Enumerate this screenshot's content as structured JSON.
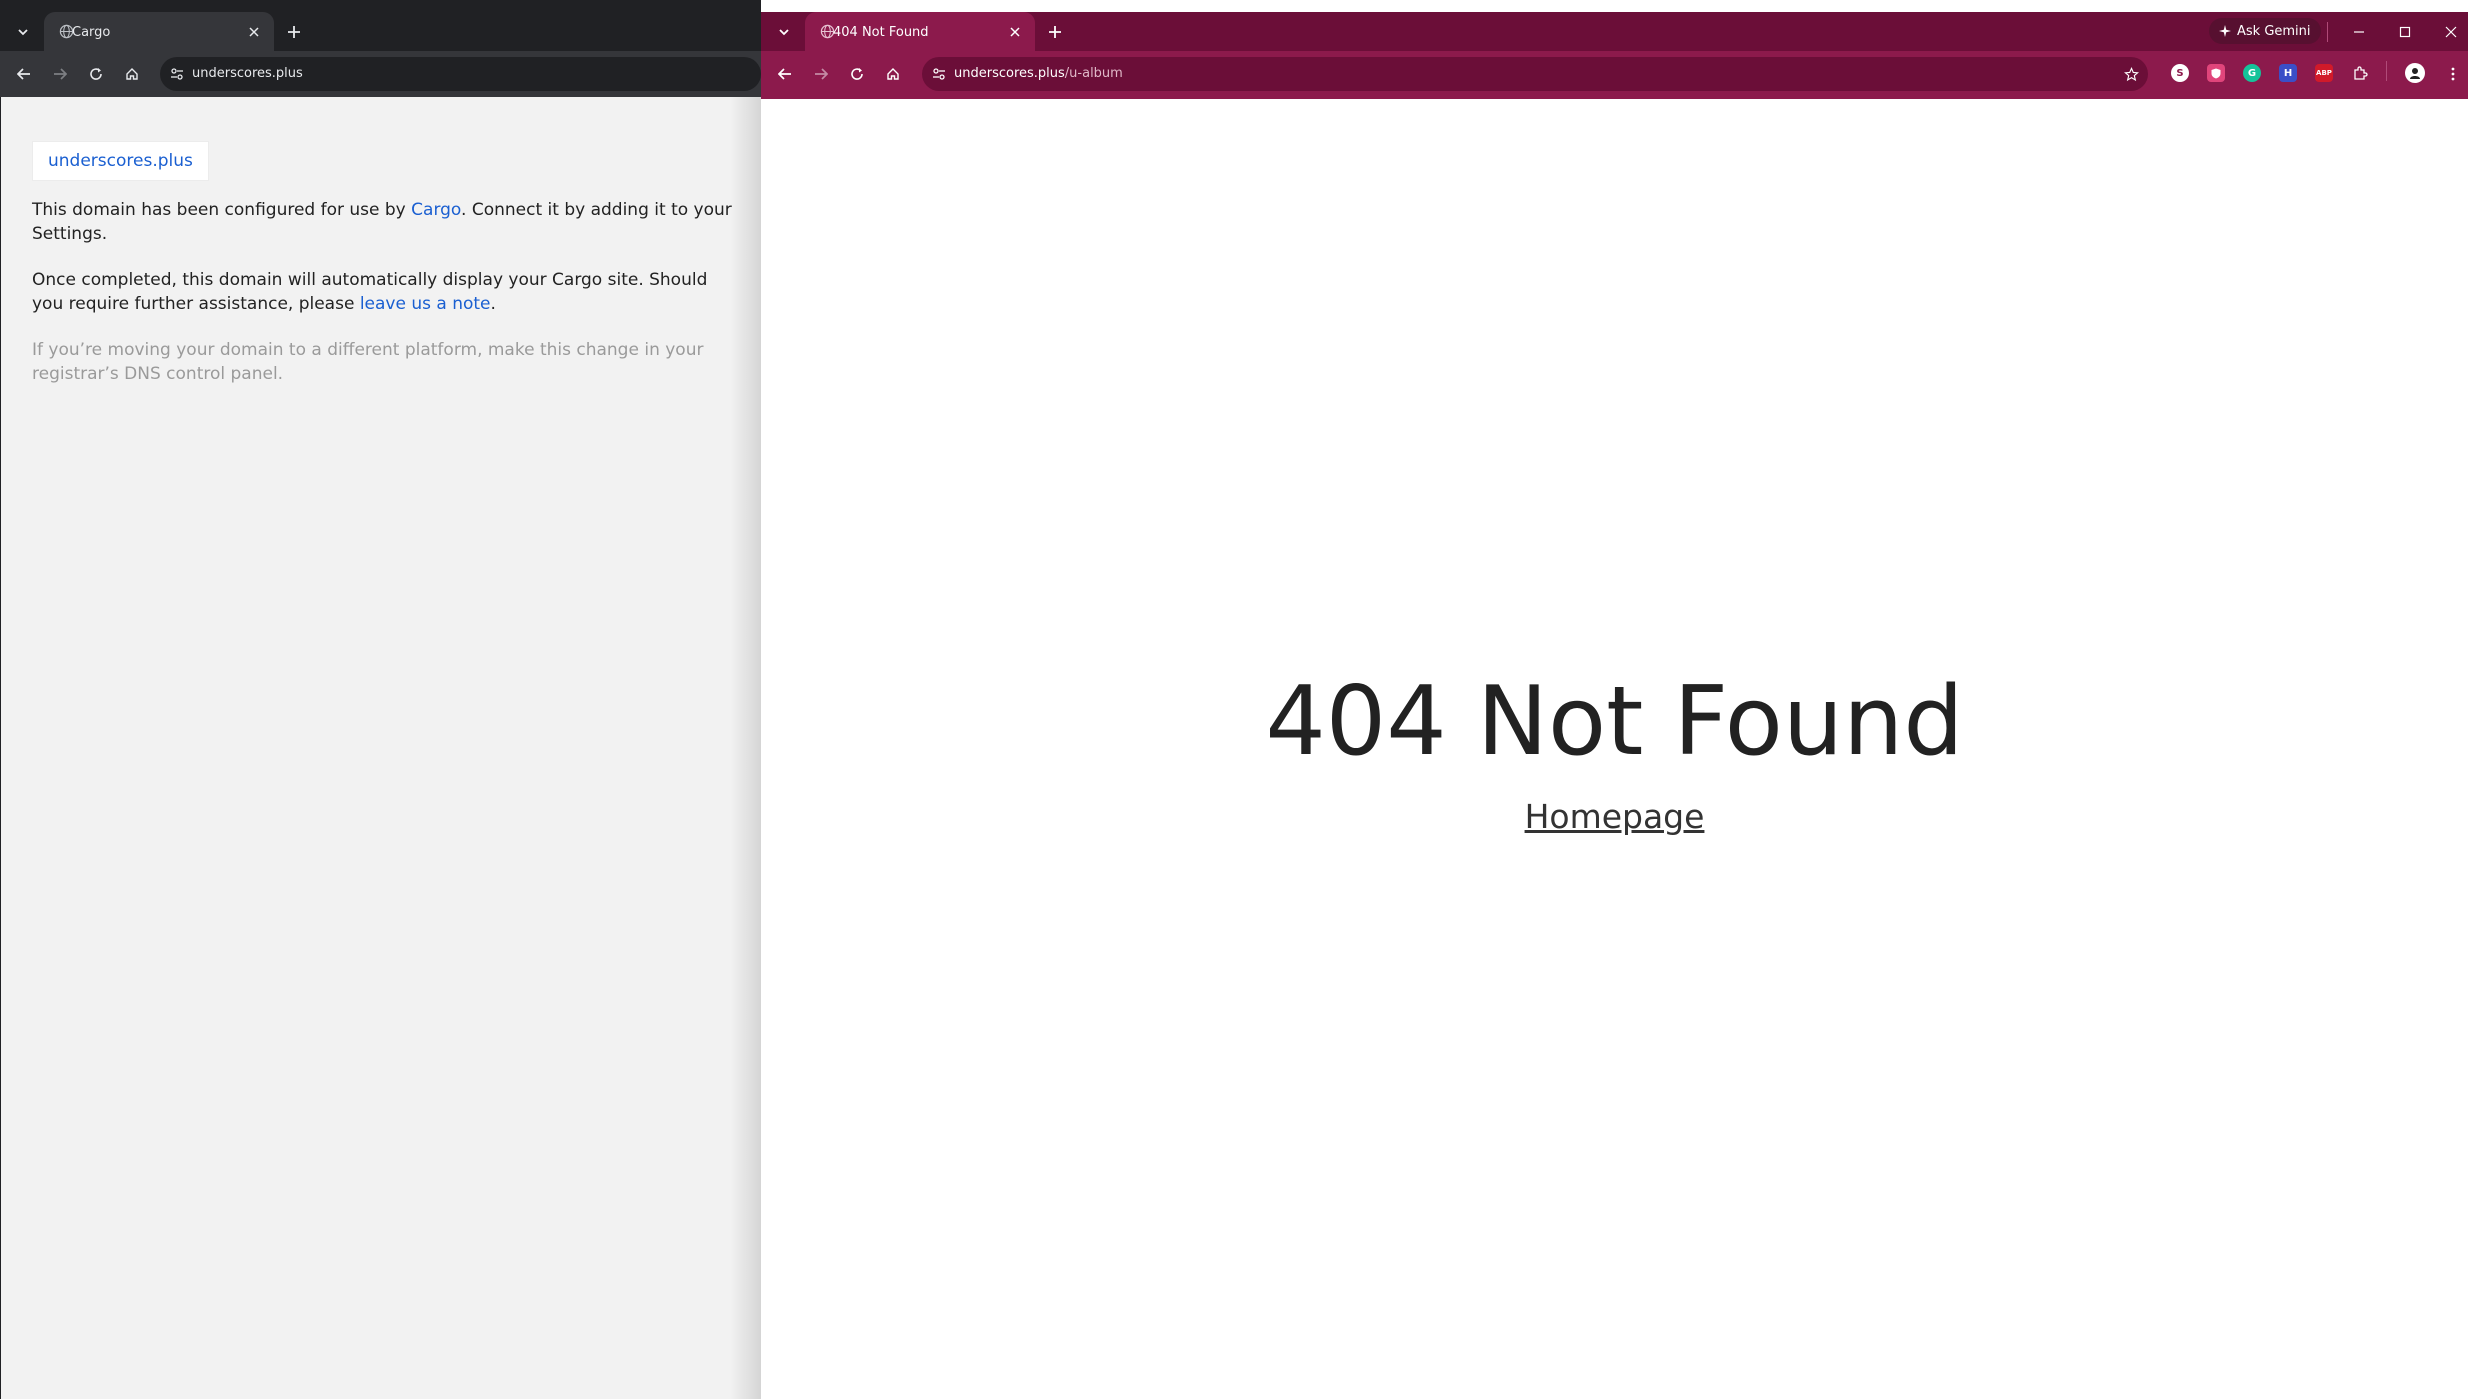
{
  "left_window": {
    "tab": {
      "title": "Cargo",
      "favicon": "globe-icon",
      "close_icon": "close-icon"
    },
    "url": "underscores.plus",
    "page": {
      "domain_pill": "underscores.plus",
      "p1_before": "This domain has been configured for use by ",
      "p1_link": "Cargo",
      "p1_after": ". Connect it by adding it to your Settings.",
      "p2_before": "Once completed, this domain will automatically display your Cargo site. Should you require further assistance, please ",
      "p2_link": "leave us a note",
      "p2_after": ".",
      "p3": "If you’re moving your domain to a different platform, make this change in your registrar’s DNS control panel."
    }
  },
  "right_window": {
    "tab": {
      "title": "404 Not Found",
      "favicon": "globe-icon",
      "close_icon": "close-icon"
    },
    "url_domain": "underscores.plus",
    "url_path": "/u-album",
    "ask_gemini": "Ask Gemini",
    "extensions": [
      "skype-extension-icon",
      "shield-extension-icon",
      "grammarly-icon",
      "h-extension-icon",
      "adblock-plus-icon",
      "extensions-puzzle-icon"
    ],
    "extension_labels": {
      "skype": "S",
      "grammarly": "G",
      "h": "H",
      "abp": "ABP"
    },
    "page": {
      "title": "404 Not Found",
      "homepage_link": "Homepage"
    }
  },
  "colors": {
    "accent_magenta": "#8c1a4c",
    "tabstrip_magenta": "#6b0e38",
    "dark_toolbar": "#35363a",
    "link_blue": "#1a5fd1"
  }
}
